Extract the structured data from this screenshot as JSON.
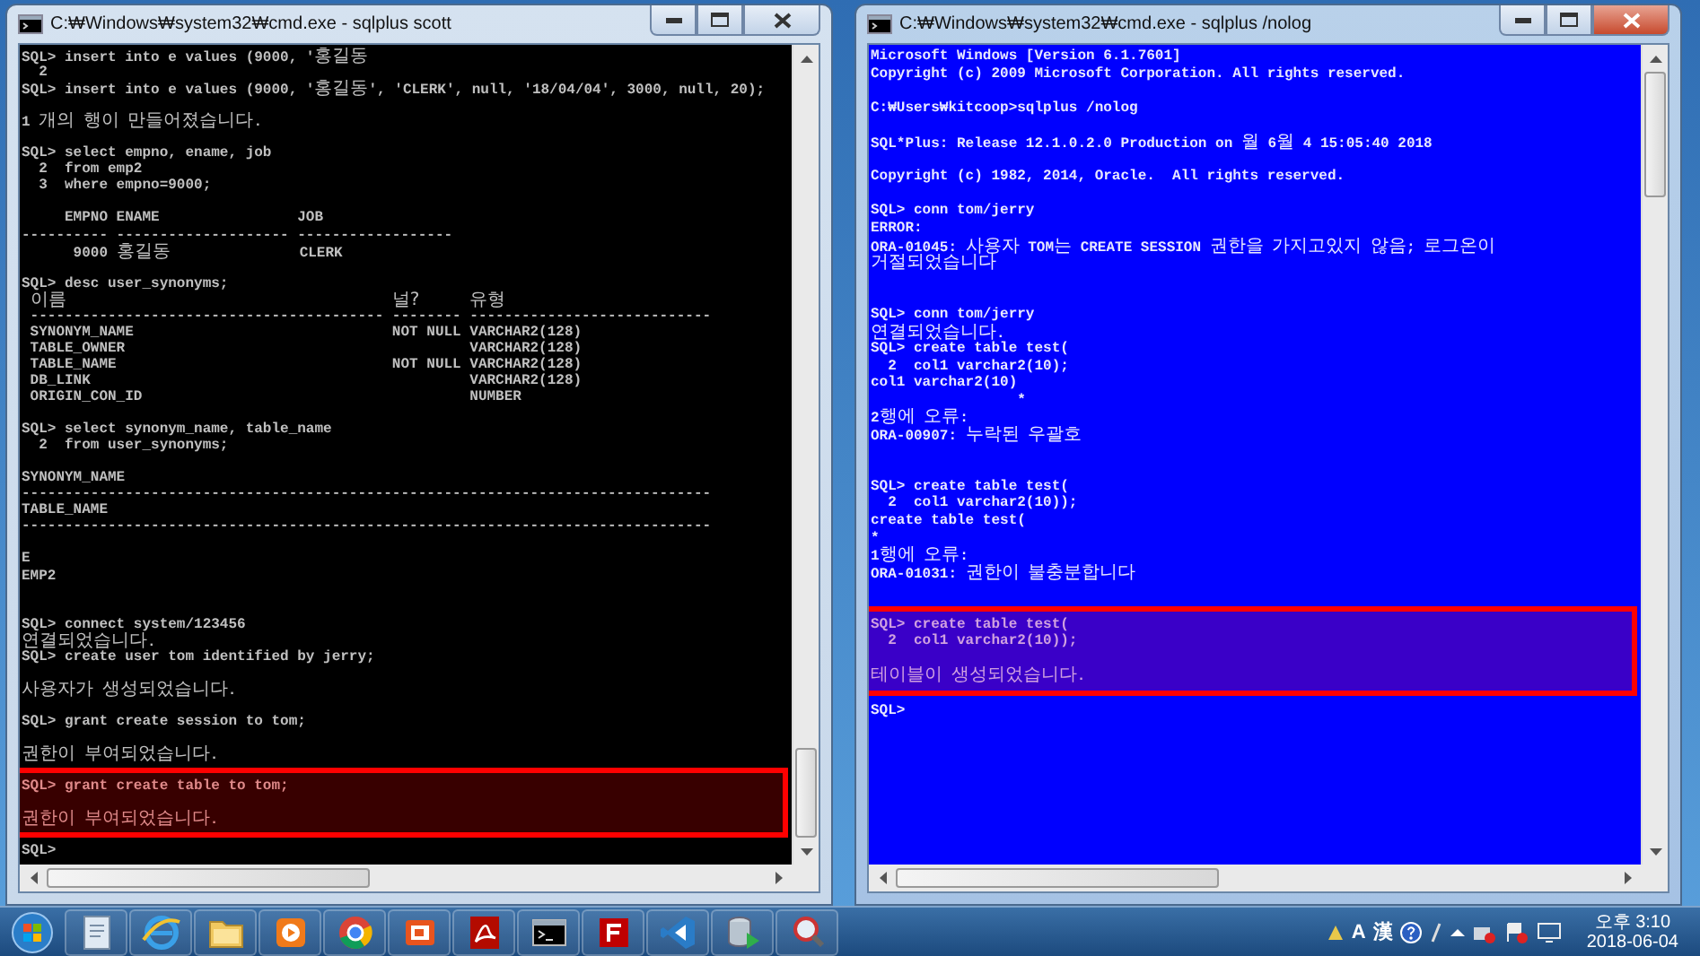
{
  "windows": [
    {
      "title": "C:₩Windows₩system32₩cmd.exe - sqlplus  scott",
      "active": false,
      "console": {
        "groups": [
          {
            "highlighted": false,
            "lines": [
              {
                "kind": "text",
                "text": "SQL> insert into e values (9000, '홍길동"
              },
              {
                "kind": "text",
                "text": "  2"
              },
              {
                "kind": "text",
                "text": "SQL> insert into e values (9000, '홍길동', 'CLERK', null, '18/04/04', 3000, null, 20);"
              },
              {
                "kind": "blank"
              },
              {
                "kind": "text",
                "text": "1 개의 행이 만들어졌습니다."
              },
              {
                "kind": "blank"
              },
              {
                "kind": "text",
                "text": "SQL> select empno, ename, job"
              },
              {
                "kind": "text",
                "text": "  2  from emp2"
              },
              {
                "kind": "text",
                "text": "  3  where empno=9000;"
              },
              {
                "kind": "blank"
              },
              {
                "kind": "text",
                "text": "     EMPNO ENAME                JOB"
              },
              {
                "kind": "text",
                "text": "---------- -------------------- ------------------"
              },
              {
                "kind": "text",
                "text": "      9000 홍길동               CLERK"
              },
              {
                "kind": "blank"
              },
              {
                "kind": "text",
                "text": "SQL> desc user_synonyms;"
              },
              {
                "kind": "columns",
                "cells": [
                  "이름",
                  "널?",
                  "유형"
                ]
              },
              {
                "kind": "text",
                "text": " ----------------------------------------- -------- ----------------------------"
              },
              {
                "kind": "text",
                "text": " SYNONYM_NAME                              NOT NULL VARCHAR2(128)"
              },
              {
                "kind": "text",
                "text": " TABLE_OWNER                                        VARCHAR2(128)"
              },
              {
                "kind": "text",
                "text": " TABLE_NAME                                NOT NULL VARCHAR2(128)"
              },
              {
                "kind": "text",
                "text": " DB_LINK                                            VARCHAR2(128)"
              },
              {
                "kind": "text",
                "text": " ORIGIN_CON_ID                                      NUMBER"
              },
              {
                "kind": "blank"
              },
              {
                "kind": "text",
                "text": "SQL> select synonym_name, table_name"
              },
              {
                "kind": "text",
                "text": "  2  from user_synonyms;"
              },
              {
                "kind": "blank"
              },
              {
                "kind": "text",
                "text": "SYNONYM_NAME"
              },
              {
                "kind": "text",
                "text": "--------------------------------------------------------------------------------"
              },
              {
                "kind": "text",
                "text": "TABLE_NAME"
              },
              {
                "kind": "text",
                "text": "--------------------------------------------------------------------------------"
              },
              {
                "kind": "blank"
              },
              {
                "kind": "text",
                "text": "E"
              },
              {
                "kind": "text",
                "text": "EMP2"
              },
              {
                "kind": "blank"
              },
              {
                "kind": "blank"
              },
              {
                "kind": "text",
                "text": "SQL> connect system/123456"
              },
              {
                "kind": "text",
                "text": "연결되었습니다."
              },
              {
                "kind": "text",
                "text": "SQL> create user tom identified by jerry;"
              },
              {
                "kind": "blank"
              },
              {
                "kind": "text",
                "text": "사용자가 생성되었습니다."
              },
              {
                "kind": "blank"
              },
              {
                "kind": "text",
                "text": "SQL> grant create session to tom;"
              },
              {
                "kind": "blank"
              },
              {
                "kind": "text",
                "text": "권한이 부여되었습니다."
              },
              {
                "kind": "blank"
              }
            ]
          },
          {
            "highlighted": true,
            "lines": [
              {
                "kind": "text",
                "text": "SQL> grant create table to tom;"
              },
              {
                "kind": "blank"
              },
              {
                "kind": "text",
                "text": "권한이 부여되었습니다."
              }
            ]
          },
          {
            "highlighted": false,
            "lines": [
              {
                "kind": "blank"
              },
              {
                "kind": "text",
                "text": "SQL>"
              }
            ]
          }
        ]
      }
    },
    {
      "title": "C:₩Windows₩system32₩cmd.exe - sqlplus  /nolog",
      "active": true,
      "console": {
        "groups": [
          {
            "highlighted": false,
            "lines": [
              {
                "kind": "text",
                "text": "Microsoft Windows [Version 6.1.7601]"
              },
              {
                "kind": "text",
                "text": "Copyright (c) 2009 Microsoft Corporation. All rights reserved."
              },
              {
                "kind": "blank"
              },
              {
                "kind": "text",
                "text": "C:₩Users₩kitcoop>sqlplus /nolog"
              },
              {
                "kind": "blank"
              },
              {
                "kind": "text",
                "text": "SQL*Plus: Release 12.1.0.2.0 Production on 월 6월 4 15:05:40 2018"
              },
              {
                "kind": "blank"
              },
              {
                "kind": "text",
                "text": "Copyright (c) 1982, 2014, Oracle.  All rights reserved."
              },
              {
                "kind": "blank"
              },
              {
                "kind": "text",
                "text": "SQL> conn tom/jerry"
              },
              {
                "kind": "text",
                "text": "ERROR:"
              },
              {
                "kind": "text",
                "text": "ORA-01045: 사용자 TOM는 CREATE SESSION 권한을 가지고있지 않음; 로그온이"
              },
              {
                "kind": "text",
                "text": "거절되었습니다"
              },
              {
                "kind": "blank"
              },
              {
                "kind": "blank"
              },
              {
                "kind": "text",
                "text": "SQL> conn tom/jerry"
              },
              {
                "kind": "text",
                "text": "연결되었습니다."
              },
              {
                "kind": "text",
                "text": "SQL> create table test("
              },
              {
                "kind": "text",
                "text": "  2  col1 varchar2(10);"
              },
              {
                "kind": "text",
                "text": "col1 varchar2(10)"
              },
              {
                "kind": "text",
                "text": "                 *"
              },
              {
                "kind": "text",
                "text": "2행에 오류:"
              },
              {
                "kind": "text",
                "text": "ORA-00907: 누락된 우괄호"
              },
              {
                "kind": "blank"
              },
              {
                "kind": "blank"
              },
              {
                "kind": "text",
                "text": "SQL> create table test("
              },
              {
                "kind": "text",
                "text": "  2  col1 varchar2(10));"
              },
              {
                "kind": "text",
                "text": "create table test("
              },
              {
                "kind": "text",
                "text": "*"
              },
              {
                "kind": "text",
                "text": "1행에 오류:"
              },
              {
                "kind": "text",
                "text": "ORA-01031: 권한이 불충분합니다"
              },
              {
                "kind": "blank"
              },
              {
                "kind": "blank"
              }
            ]
          },
          {
            "highlighted": true,
            "lines": [
              {
                "kind": "text",
                "text": "SQL> create table test("
              },
              {
                "kind": "text",
                "text": "  2  col1 varchar2(10));"
              },
              {
                "kind": "blank"
              },
              {
                "kind": "text",
                "text": "테이블이 생성되었습니다."
              }
            ]
          },
          {
            "highlighted": false,
            "lines": [
              {
                "kind": "blank"
              },
              {
                "kind": "text",
                "text": "SQL>"
              }
            ]
          }
        ]
      }
    }
  ],
  "taskbar": {
    "tray": {
      "ime_mode": "A",
      "ime_hanja": "漢",
      "time": "오후 3:10",
      "date": "2018-06-04"
    }
  }
}
